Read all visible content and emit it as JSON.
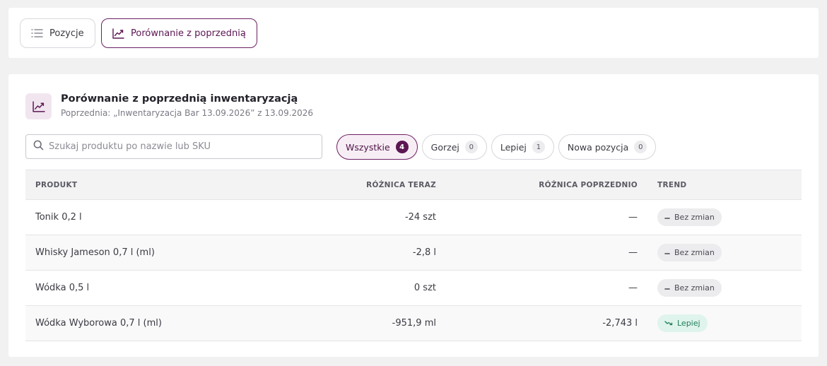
{
  "tabs": [
    {
      "label": "Pozycje",
      "icon": "list-icon",
      "active": false
    },
    {
      "label": "Porównanie z poprzednią",
      "icon": "trend-chart-icon",
      "active": true
    }
  ],
  "header": {
    "title": "Porównanie z poprzednią inwentaryzacją",
    "subtitle": "Poprzednia: „Inwentaryzacja Bar 13.09.2026” z 13.09.2026",
    "icon": "trend-chart-icon"
  },
  "search": {
    "placeholder": "Szukaj produktu po nazwie lub SKU",
    "value": ""
  },
  "filters": [
    {
      "label": "Wszystkie",
      "count": "4",
      "active": true
    },
    {
      "label": "Gorzej",
      "count": "0",
      "active": false
    },
    {
      "label": "Lepiej",
      "count": "1",
      "active": false
    },
    {
      "label": "Nowa pozycja",
      "count": "0",
      "active": false
    }
  ],
  "table": {
    "columns": [
      "PRODUKT",
      "RÓŻNICA TERAZ",
      "RÓŻNICA POPRZEDNIO",
      "TREND"
    ],
    "rows": [
      {
        "product": "Tonik 0,2 l",
        "diff_now": "-24 szt",
        "diff_prev": "—",
        "trend": "Bez zmian"
      },
      {
        "product": "Whisky Jameson 0,7 l (ml)",
        "diff_now": "-2,8 l",
        "diff_prev": "—",
        "trend": "Bez zmian"
      },
      {
        "product": "Wódka 0,5 l",
        "diff_now": "0 szt",
        "diff_prev": "—",
        "trend": "Bez zmian"
      },
      {
        "product": "Wódka Wyborowa 0,7 l (ml)",
        "diff_now": "-951,9 ml",
        "diff_prev": "-2,743 l",
        "trend": "Lepiej"
      }
    ]
  },
  "colors": {
    "accent": "#5c1653",
    "negative": "#e0475e",
    "better_bg": "#dff4ec",
    "better_text": "#1f7d5a",
    "neutral_bg": "#ececee"
  }
}
